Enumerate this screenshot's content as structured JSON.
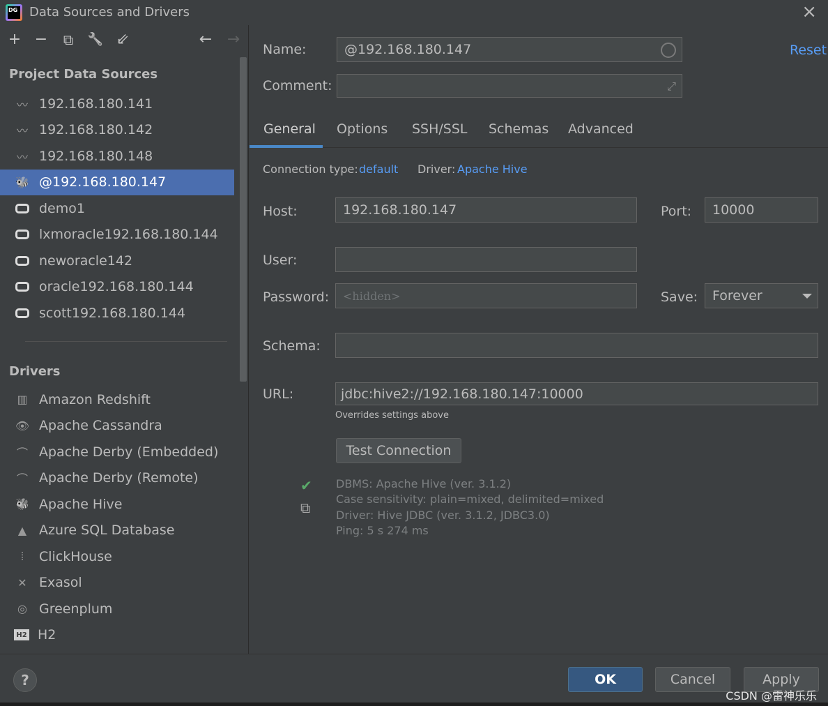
{
  "window": {
    "title": "Data Sources and Drivers",
    "logo_text": "DG",
    "close_glyph": "×"
  },
  "toolbar": {
    "add": "+",
    "remove": "−",
    "copy": "⧉",
    "settings": "🔧",
    "import": "⇙",
    "back": "←",
    "forward": "→"
  },
  "sidebar": {
    "project_title": "Project Data Sources",
    "data_sources": [
      {
        "label": "192.168.180.141",
        "icon": "mysql-dolphin-icon",
        "selected": false
      },
      {
        "label": "192.168.180.142",
        "icon": "mysql-dolphin-icon",
        "selected": false
      },
      {
        "label": "192.168.180.148",
        "icon": "mysql-dolphin-icon",
        "selected": false
      },
      {
        "label": "@192.168.180.147",
        "icon": "hive-bee-icon",
        "selected": true
      },
      {
        "label": "demo1",
        "icon": "oracle-icon",
        "selected": false
      },
      {
        "label": "lxmoracle192.168.180.144",
        "icon": "oracle-icon",
        "selected": false
      },
      {
        "label": "neworacle142",
        "icon": "oracle-icon",
        "selected": false
      },
      {
        "label": "oracle192.168.180.144",
        "icon": "oracle-icon",
        "selected": false
      },
      {
        "label": "scott192.168.180.144",
        "icon": "oracle-icon",
        "selected": false
      }
    ],
    "drivers_title": "Drivers",
    "drivers": [
      {
        "label": "Amazon Redshift",
        "icon": "redshift-icon"
      },
      {
        "label": "Apache Cassandra",
        "icon": "cassandra-eye-icon"
      },
      {
        "label": "Apache Derby (Embedded)",
        "icon": "derby-hat-icon"
      },
      {
        "label": "Apache Derby (Remote)",
        "icon": "derby-hat-icon"
      },
      {
        "label": "Apache Hive",
        "icon": "hive-bee-icon"
      },
      {
        "label": "Azure SQL Database",
        "icon": "azure-icon"
      },
      {
        "label": "ClickHouse",
        "icon": "clickhouse-bars-icon"
      },
      {
        "label": "Exasol",
        "icon": "exasol-x-icon"
      },
      {
        "label": "Greenplum",
        "icon": "greenplum-circle-icon"
      },
      {
        "label": "H2",
        "icon": "h2-icon"
      }
    ]
  },
  "form": {
    "name_label": "Name:",
    "name_value": "@192.168.180.147",
    "reset": "Reset",
    "comment_label": "Comment:",
    "comment_value": "",
    "tabs": [
      "General",
      "Options",
      "SSH/SSL",
      "Schemas",
      "Advanced"
    ],
    "active_tab": "General",
    "connection_type_label": "Connection type:",
    "connection_type_value": "default",
    "driver_label": "Driver:",
    "driver_value": "Apache Hive",
    "host_label": "Host:",
    "host_value": "192.168.180.147",
    "port_label": "Port:",
    "port_value": "10000",
    "user_label": "User:",
    "user_value": "",
    "password_label": "Password:",
    "password_placeholder": "<hidden>",
    "save_label": "Save:",
    "save_value": "Forever",
    "schema_label": "Schema:",
    "schema_value": "",
    "url_label": "URL:",
    "url_value": "jdbc:hive2://192.168.180.147:10000",
    "url_hint": "Overrides settings above",
    "test_button": "Test Connection",
    "status": [
      "DBMS: Apache Hive (ver. 3.1.2)",
      "Case sensitivity: plain=mixed, delimited=mixed",
      "Driver: Hive JDBC (ver. 3.1.2, JDBC3.0)",
      "Ping: 5 s 274 ms"
    ]
  },
  "footer": {
    "help": "?",
    "ok": "OK",
    "cancel": "Cancel",
    "apply": "Apply",
    "watermark": "CSDN @雷神乐乐"
  },
  "colors": {
    "background": "#3c3f41",
    "selection": "#4b6eaf",
    "link": "#589df6",
    "tab_underline": "#4a88c7",
    "success_check": "#59a869"
  }
}
